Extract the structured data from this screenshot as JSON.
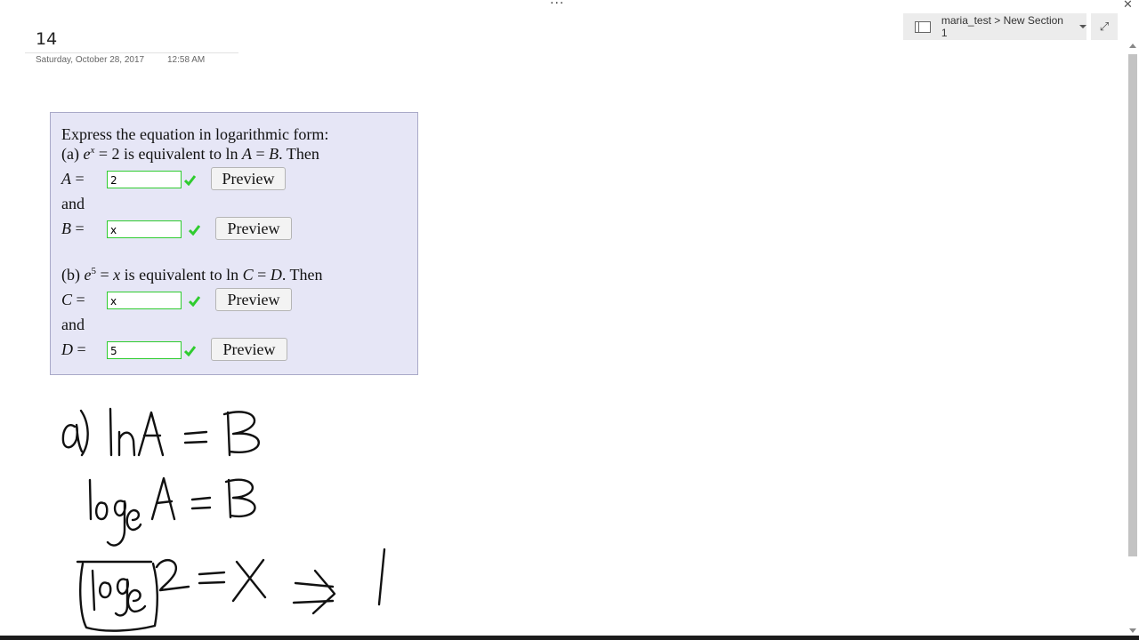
{
  "window": {
    "more_label": "···",
    "close_label": "✕"
  },
  "page": {
    "title": "14",
    "date": "Saturday, October 28, 2017",
    "time": "12:58 AM"
  },
  "section_picker": {
    "label": "maria_test > New Section 1",
    "expand_label": "⤢"
  },
  "problem": {
    "heading": "Express the equation in logarithmic form:",
    "part_a": {
      "prefix": "(a) ",
      "eq": "e",
      "exp": "x",
      "rest": " = 2 is equivalent to ln ",
      "A": "A",
      "eq2": " = ",
      "B": "B",
      "suffix": ". Then"
    },
    "part_b": {
      "prefix": "(b) ",
      "eq": "e",
      "exp": "5",
      "rest": " = ",
      "x": "x",
      "rest2": " is equivalent to ln ",
      "C": "C",
      "eq2": " = ",
      "D": "D",
      "suffix": ". Then"
    },
    "and_label": "and",
    "rows": [
      {
        "var": "A",
        "eq": " =",
        "value": "2",
        "button": "Preview"
      },
      {
        "var": "B",
        "eq": " =",
        "value": "x",
        "button": "Preview"
      },
      {
        "var": "C",
        "eq": " =",
        "value": "x",
        "button": "Preview"
      },
      {
        "var": "D",
        "eq": " =",
        "value": "5",
        "button": "Preview"
      }
    ],
    "colors": {
      "box": "#e6e6f6",
      "correct": "#2fcc2f"
    }
  }
}
